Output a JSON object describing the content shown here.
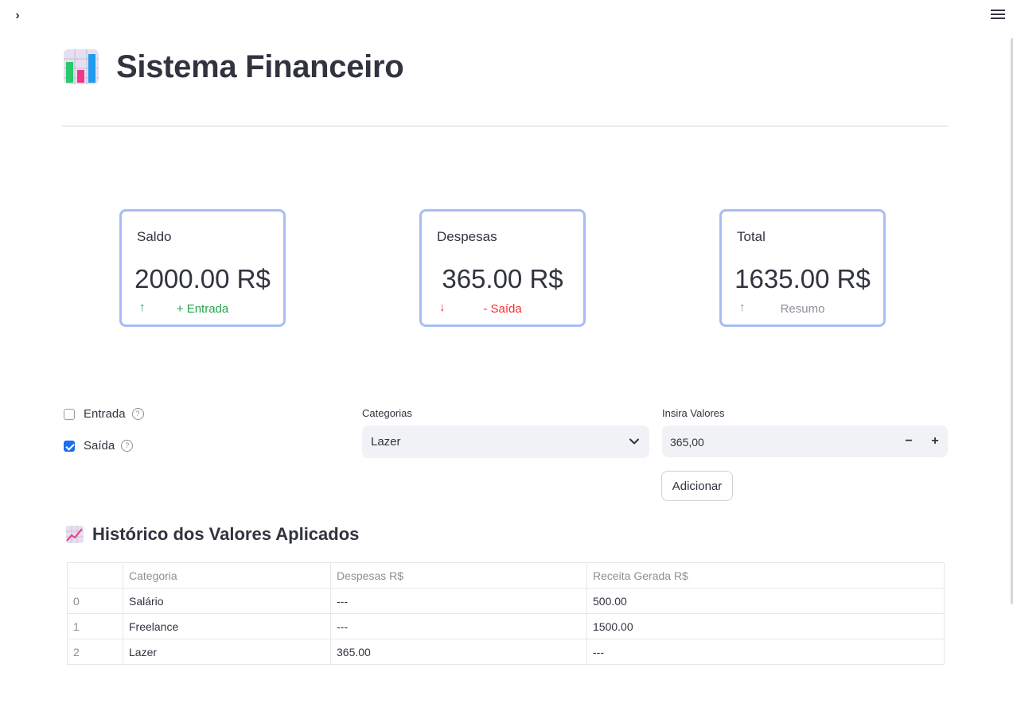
{
  "app": {
    "title": "Sistema Financeiro"
  },
  "header": {
    "sidebar_toggle_icon": "chevron-right-icon",
    "menu_icon": "hamburger-menu-icon"
  },
  "metrics": [
    {
      "label": "Saldo",
      "value": "2000.00 R$",
      "delta": "+ Entrada",
      "arrow": "↑",
      "color": "#21a64a"
    },
    {
      "label": "Despesas",
      "value": "365.00 R$",
      "delta": "- Saída",
      "arrow": "↓",
      "color": "#ff2b2b"
    },
    {
      "label": "Total",
      "value": "1635.00 R$",
      "delta": "Resumo",
      "arrow": "↑",
      "color": "#8c8f98"
    }
  ],
  "form": {
    "checkboxes": [
      {
        "label": "Entrada",
        "checked": false
      },
      {
        "label": "Saída",
        "checked": true
      }
    ],
    "select": {
      "label": "Categorias",
      "value": "Lazer"
    },
    "number": {
      "label": "Insira Valores",
      "value": "365,00",
      "minus": "−",
      "plus": "+"
    },
    "submit_label": "Adicionar"
  },
  "history": {
    "title": "Histórico dos Valores Aplicados",
    "columns": [
      "",
      "Categoria",
      "Despesas R$",
      "Receita Gerada R$"
    ],
    "rows": [
      [
        "0",
        "Salário",
        "---",
        "500.00"
      ],
      [
        "1",
        "Freelance",
        "---",
        "1500.00"
      ],
      [
        "2",
        "Lazer",
        "365.00",
        "---"
      ]
    ]
  },
  "colors": {
    "accent": "#1c6ff0",
    "card_border": "#a8bdf4",
    "positive": "#21a64a",
    "negative": "#ff2b2b",
    "neutral": "#8c8f98"
  }
}
